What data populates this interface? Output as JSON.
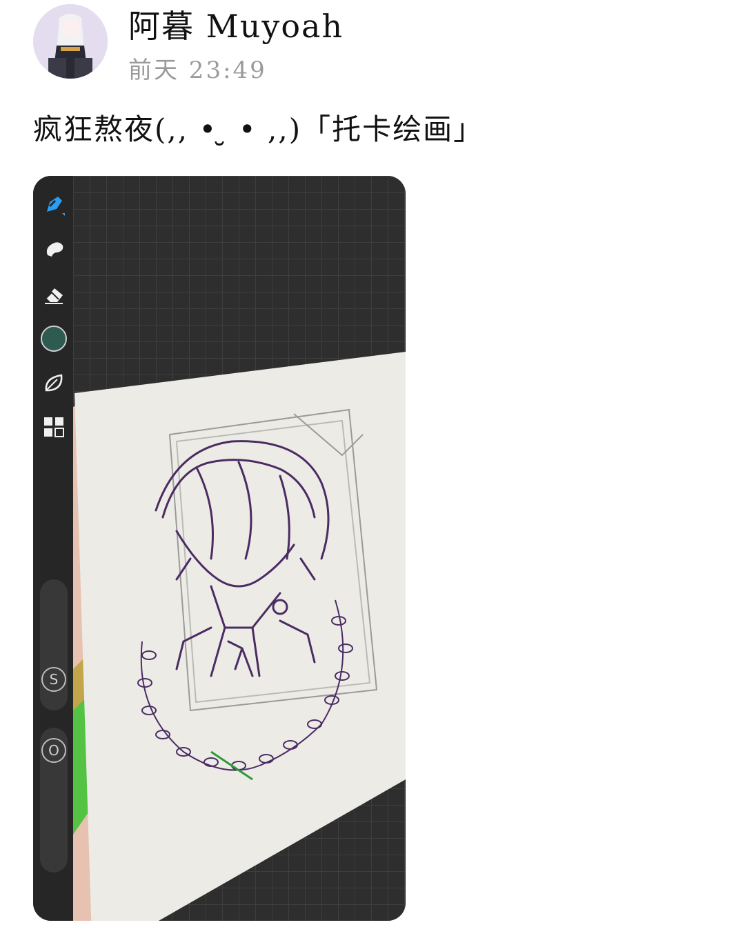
{
  "post": {
    "username": "阿暮 Muyoah",
    "timestamp": "前天 23:49",
    "text": "疯狂熬夜(,, •  ̮̮ • ,,)「托卡绘画」",
    "avatar_colors": {
      "bg": "#e4ddef",
      "hair": "#f2f2f4",
      "outfit": "#2a2a34"
    }
  },
  "app": {
    "tools": [
      {
        "name": "brush-icon",
        "active": true,
        "color": "#2a9df4"
      },
      {
        "name": "smudge-icon"
      },
      {
        "name": "eraser-icon"
      },
      {
        "name": "color-swatch",
        "color": "#2d5b50"
      },
      {
        "name": "leaf-icon"
      },
      {
        "name": "layers-icon"
      }
    ],
    "size_slider_label": "S",
    "opacity_slider_label": "O"
  },
  "canvas": {
    "content": "photo-of-sketch-card",
    "ink_color": "#4a2c63",
    "paper_color": "#ecebe6"
  }
}
